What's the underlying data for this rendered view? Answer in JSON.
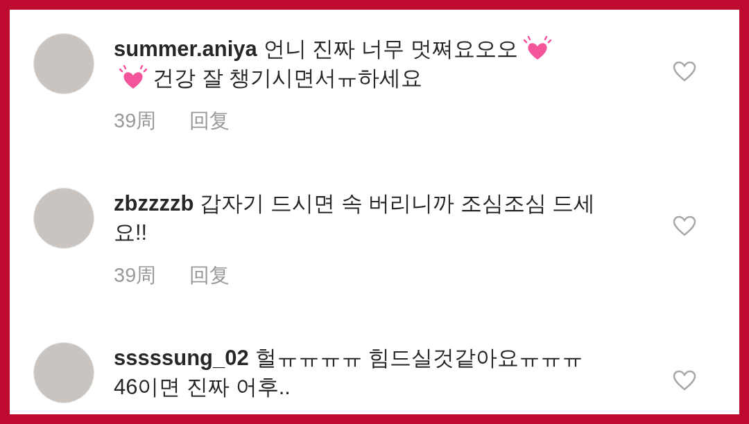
{
  "comments": [
    {
      "username": "summer.aniya",
      "liked": false,
      "lines": [
        [
          {
            "kind": "text",
            "text": "언니 진짜 너무 멋쪄요오오"
          },
          {
            "kind": "emoji"
          }
        ],
        [
          {
            "kind": "emoji"
          },
          {
            "kind": "text",
            "text": "건강 잘 챙기시면서ㅠ하세요"
          }
        ]
      ],
      "time": "39周",
      "reply": "回复"
    },
    {
      "username": "zbzzzzb",
      "liked": false,
      "lines": [
        [
          {
            "kind": "text",
            "text": "갑자기 드시면 속 버리니까 조심조심 드세"
          }
        ],
        [
          {
            "kind": "text",
            "text": "요!!"
          }
        ]
      ],
      "time": "39周",
      "reply": "回复"
    },
    {
      "username": "sssssung_02",
      "liked": false,
      "lines": [
        [
          {
            "kind": "text",
            "text": "헐ㅠㅠㅠㅠ 힘드실것같아요ㅠㅠㅠ"
          }
        ],
        [
          {
            "kind": "text",
            "text": "46이면 진짜 어후.."
          }
        ]
      ]
    }
  ]
}
